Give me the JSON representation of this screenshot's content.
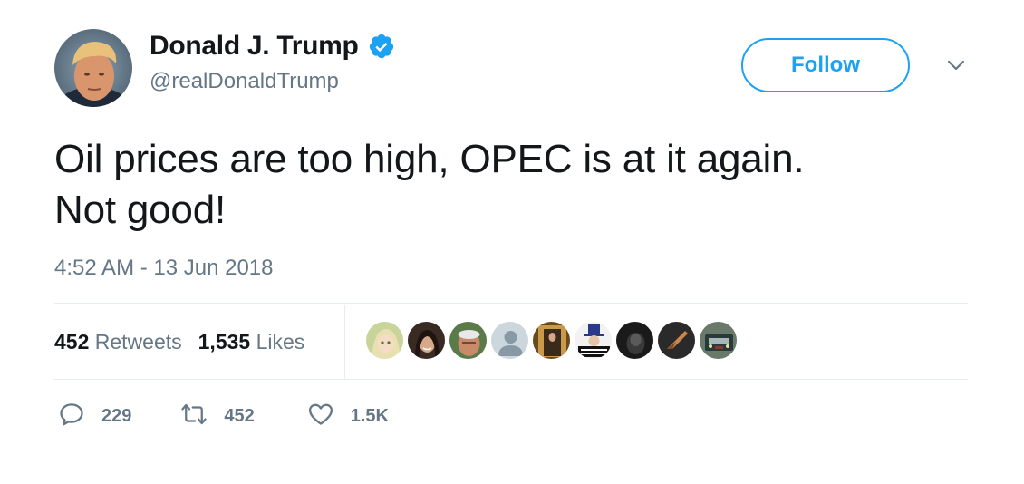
{
  "author": {
    "name": "Donald J. Trump",
    "handle": "@realDonaldTrump",
    "verified": true
  },
  "follow_label": "Follow",
  "tweet": {
    "text_line1": "Oil prices are too high, OPEC is at it again.",
    "text_line2": "Not good!",
    "timestamp": "4:52 AM - 13 Jun 2018"
  },
  "stats": {
    "retweets_count": "452",
    "retweets_label": "Retweets",
    "likes_count": "1,535",
    "likes_label": "Likes"
  },
  "liker_avatars": [
    "anime-avatar",
    "woman-avatar",
    "man-avatar",
    "default-avatar",
    "photo-avatar",
    "uncle-sam-avatar",
    "dark-avatar",
    "arrow-avatar",
    "truck-avatar"
  ],
  "actions": {
    "reply_count": "229",
    "retweet_count": "452",
    "like_count": "1.5K"
  },
  "colors": {
    "accent": "#1da1f2",
    "secondary_text": "#657786",
    "primary_text": "#14171a",
    "divider": "#e6ecf0"
  },
  "icons": {
    "verified": "verified-badge-icon",
    "caret": "chevron-down-icon",
    "reply": "reply-icon",
    "retweet": "retweet-icon",
    "like": "heart-icon"
  }
}
